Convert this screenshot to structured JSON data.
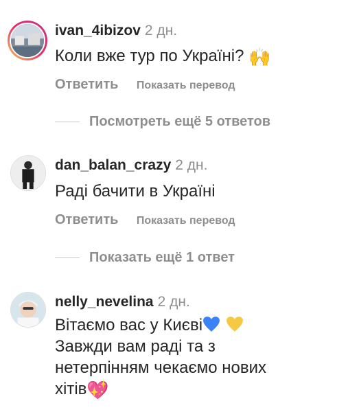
{
  "comments": [
    {
      "username": "ivan_4ibizov",
      "time": "2 дн.",
      "text": "Коли вже тур по Україні?",
      "emoji": "🙌",
      "reply_label": "Ответить",
      "translate_label": "Показать перевод"
    },
    {
      "username": "dan_balan_crazy",
      "time": "2 дн.",
      "text": "Раді бачити в Україні",
      "reply_label": "Ответить",
      "translate_label": "Показать перевод"
    },
    {
      "username": "nelly_nevelina",
      "time": "2 дн.",
      "text_line1": "Вітаємо вас у Києві",
      "text_line2": "Завжди вам раді та з",
      "text_line3": "нетерпінням чекаємо нових",
      "text_line4": "хітів",
      "emoji_sparkle": "💖"
    }
  ],
  "view_more_1": "Посмотреть ещё 5 ответов",
  "view_more_2": "Показать ещё 1 ответ",
  "colors": {
    "heart_blue": "#3b82f6",
    "heart_yellow": "#f6c945",
    "muted": "#8e8e8e"
  }
}
